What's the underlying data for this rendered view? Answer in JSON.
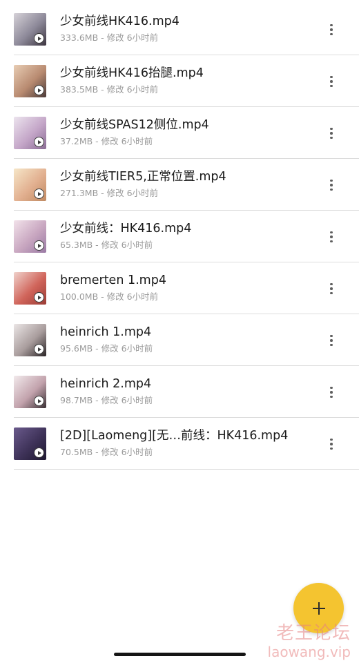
{
  "files": [
    {
      "name": "少女前线HK416.mp4",
      "size": "333.6MB",
      "modified": "修改 6小时前",
      "thumb_colors": [
        "#d6d2d8",
        "#8c8898",
        "#3c3440"
      ]
    },
    {
      "name": "少女前线HK416抬腿.mp4",
      "size": "383.5MB",
      "modified": "修改 6小时前",
      "thumb_colors": [
        "#e8cdb4",
        "#b88a70",
        "#4a3a38"
      ]
    },
    {
      "name": "少女前线SPAS12侧位.mp4",
      "size": "37.2MB",
      "modified": "修改 6小时前",
      "thumb_colors": [
        "#ece4ee",
        "#c4a6c8",
        "#8a6c94"
      ]
    },
    {
      "name": "少女前线TIER5,正常位置.mp4",
      "size": "271.3MB",
      "modified": "修改 6小时前",
      "thumb_colors": [
        "#f6e6c8",
        "#e2b090",
        "#c08a62"
      ]
    },
    {
      "name": "少女前线：HK416.mp4",
      "size": "65.3MB",
      "modified": "修改 6小时前",
      "thumb_colors": [
        "#f2e2ea",
        "#c8a6c0",
        "#9a7aa4"
      ]
    },
    {
      "name": "bremerten 1.mp4",
      "size": "100.0MB",
      "modified": "修改 6小时前",
      "thumb_colors": [
        "#f0d2cc",
        "#d0645a",
        "#9a3c36"
      ]
    },
    {
      "name": "heinrich 1.mp4",
      "size": "95.6MB",
      "modified": "修改 6小时前",
      "thumb_colors": [
        "#ebe6e6",
        "#a89c9c",
        "#2a2426"
      ]
    },
    {
      "name": "heinrich 2.mp4",
      "size": "98.7MB",
      "modified": "修改 6小时前",
      "thumb_colors": [
        "#f2eaec",
        "#c2a2ac",
        "#3a3034"
      ]
    },
    {
      "name": "[2D][Laomeng][无…前线：HK416.mp4",
      "size": "70.5MB",
      "modified": "修改 6小时前",
      "thumb_colors": [
        "#6a5a8c",
        "#3e3258",
        "#1e1830"
      ]
    }
  ],
  "meta_separator": " - ",
  "fab": {
    "icon": "plus-icon",
    "color": "#f4c430"
  },
  "watermark": {
    "title": "老王论坛",
    "url": "laowang.vip"
  }
}
